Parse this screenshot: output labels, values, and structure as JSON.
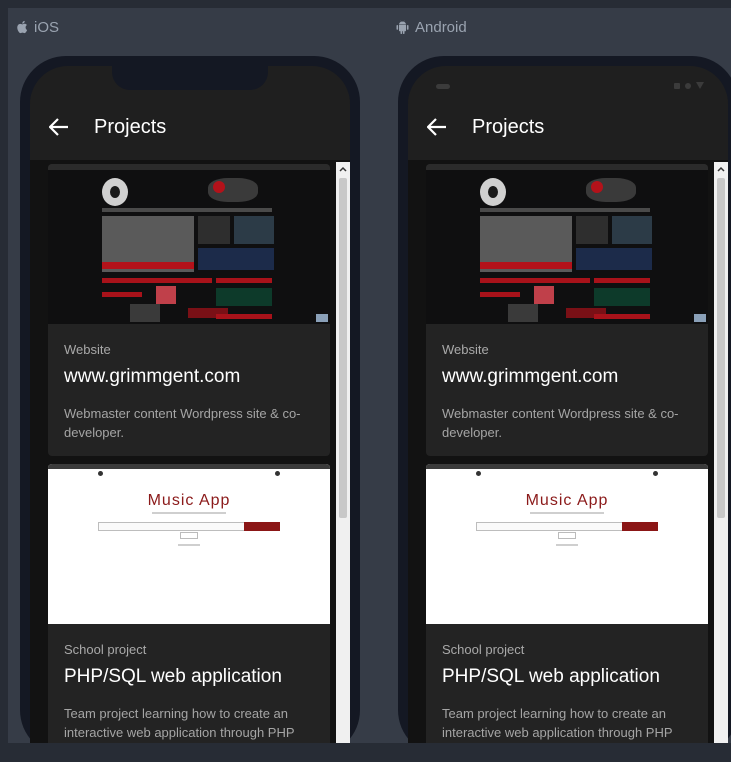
{
  "platforms": [
    {
      "id": "ios",
      "label": "iOS",
      "icon": "apple-icon"
    },
    {
      "id": "android",
      "label": "Android",
      "icon": "android-icon"
    }
  ],
  "appbar": {
    "title": "Projects",
    "back_icon": "arrow-left-icon"
  },
  "projects": [
    {
      "kicker": "Website",
      "title": "www.grimmgent.com",
      "description": "Webmaster content Wordpress site & co-developer."
    },
    {
      "kicker": "School project",
      "title": "PHP/SQL web application",
      "description": "Team project learning how to create an interactive web application through PHP",
      "image_title": "Music App"
    }
  ],
  "colors": {
    "background": "#363c47",
    "device_frame": "#141823",
    "appbar": "#1f1f1f",
    "card": "#232323",
    "accent_red": "#8b1a1a"
  }
}
